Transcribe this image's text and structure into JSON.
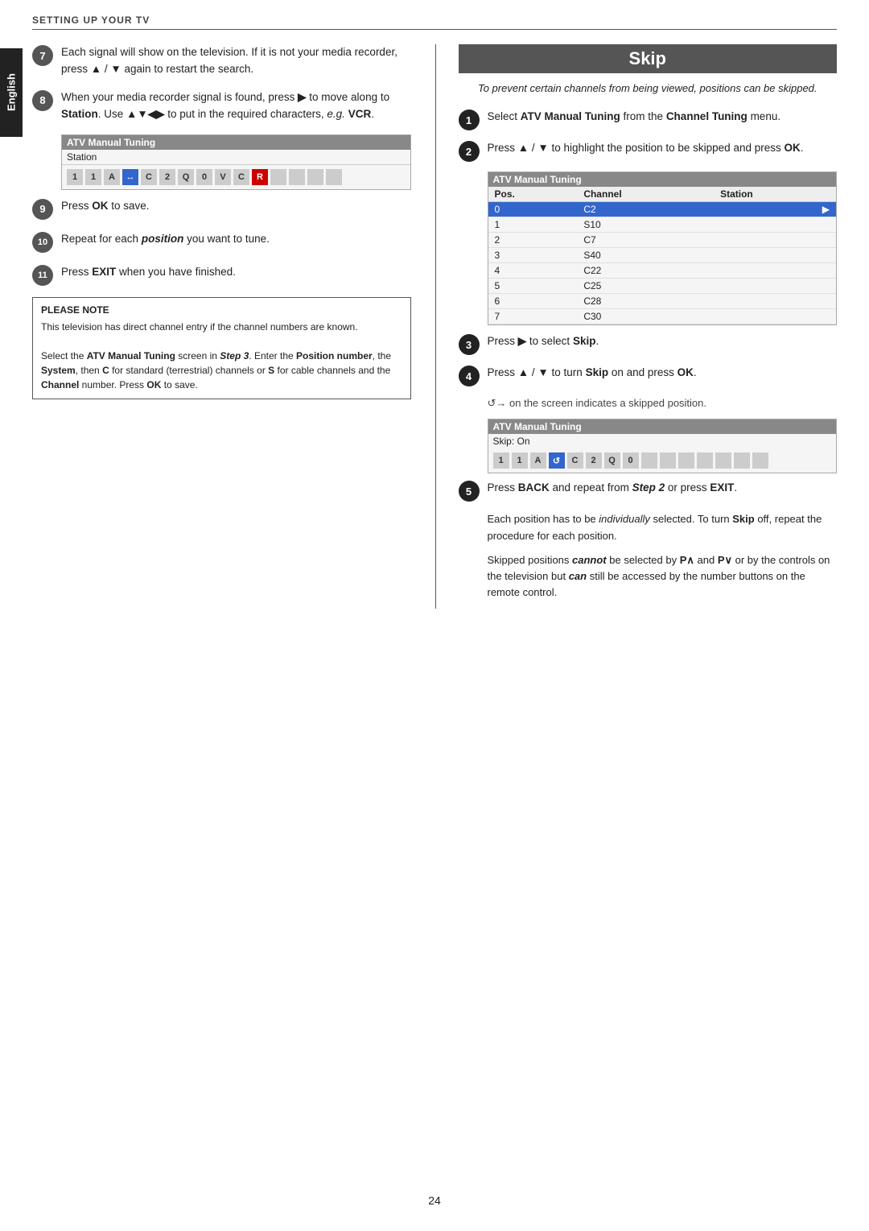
{
  "header": {
    "label": "SETTING UP YOUR TV"
  },
  "english_tab": "English",
  "left_col": {
    "steps": [
      {
        "num": "7",
        "text": "Each signal will show on the television. If it is not your media recorder, press ▲ / ▼ again to restart the search."
      },
      {
        "num": "8",
        "text": "When your media recorder signal is found, press ▶ to move along to Station. Use ▲▼◀▶ to put in the required characters, e.g. VCR."
      },
      {
        "num": "9",
        "text": "Press OK to save."
      },
      {
        "num": "10",
        "text": "Repeat for each position you want to tune."
      },
      {
        "num": "11",
        "text": "Press EXIT when you have finished."
      }
    ],
    "atv_box": {
      "title": "ATV Manual Tuning",
      "subtitle": "Station",
      "chars": [
        "1",
        "1",
        "A",
        "↔",
        "C",
        "2",
        "Q",
        "0",
        "V",
        "C",
        "R",
        "",
        "",
        "",
        ""
      ]
    },
    "note": {
      "title": "PLEASE NOTE",
      "lines": [
        "This television has direct channel entry if the channel numbers are known.",
        "Select the ATV Manual Tuning screen in Step 3. Enter the Position number, the System, then C for standard (terrestrial) channels or S for cable channels and the Channel number. Press OK to save."
      ]
    }
  },
  "right_col": {
    "skip_title": "Skip",
    "skip_subtitle": "To prevent certain channels from being viewed, positions can be skipped.",
    "steps": [
      {
        "num": "1",
        "text": "Select ATV Manual Tuning from the Channel Tuning menu."
      },
      {
        "num": "2",
        "text": "Press ▲ / ▼ to highlight the position to be skipped and press OK."
      },
      {
        "num": "3",
        "text": "Press ▶ to select Skip."
      },
      {
        "num": "4",
        "text": "Press ▲ / ▼ to turn Skip on and press OK."
      },
      {
        "num": "5",
        "text": "Press BACK and repeat from Step 2 or press EXIT."
      }
    ],
    "atv_table": {
      "title": "ATV Manual Tuning",
      "columns": [
        "Pos.",
        "Channel",
        "Station"
      ],
      "rows": [
        {
          "pos": "0",
          "channel": "C2",
          "station": "",
          "highlight": true
        },
        {
          "pos": "1",
          "channel": "S10",
          "station": "",
          "highlight": false
        },
        {
          "pos": "2",
          "channel": "C7",
          "station": "",
          "highlight": false
        },
        {
          "pos": "3",
          "channel": "S40",
          "station": "",
          "highlight": false
        },
        {
          "pos": "4",
          "channel": "C22",
          "station": "",
          "highlight": false
        },
        {
          "pos": "5",
          "channel": "C25",
          "station": "",
          "highlight": false
        },
        {
          "pos": "6",
          "channel": "C28",
          "station": "",
          "highlight": false
        },
        {
          "pos": "7",
          "channel": "C30",
          "station": "",
          "highlight": false
        }
      ]
    },
    "skipped_indicator": "↺→  on the screen indicates a skipped position.",
    "skip_on_box": {
      "title": "ATV Manual Tuning",
      "subtitle": "Skip: On",
      "chars": [
        "1",
        "1",
        "A",
        "↺",
        "C",
        "2",
        "Q",
        "0",
        "",
        "",
        "",
        "",
        "",
        "",
        ""
      ]
    },
    "para1": "Each position has to be individually selected. To turn Skip off, repeat the procedure for each position.",
    "para2": "Skipped positions cannot be selected by P∧ and P∨ or by the controls on the television but can still be accessed by the number buttons on the remote control."
  },
  "page_number": "24"
}
